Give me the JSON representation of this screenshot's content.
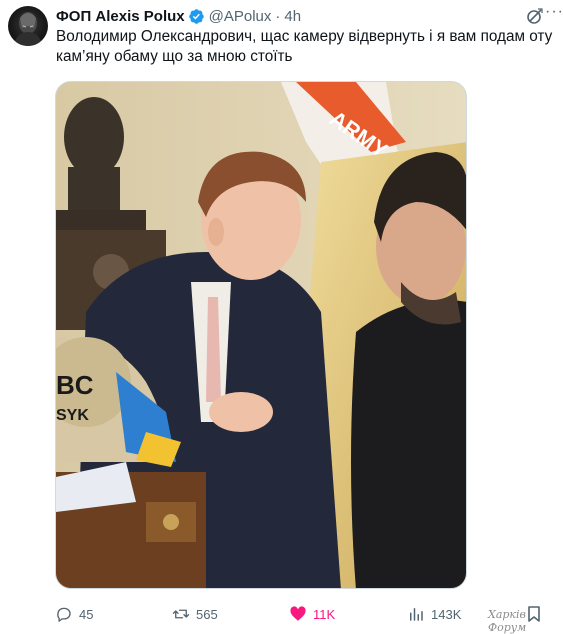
{
  "tweet": {
    "author_name": "ФОП Alexis Polux",
    "handle": "@APolux",
    "separator": "·",
    "time": "4h",
    "text": "Володимир Олександрович, щас камеру відвернуть і я вам подам оту\nкам’яну обаму що за мною стоїть",
    "avatar_icon": "dark-avatar-icon",
    "verified_icon": "verified-badge-icon"
  },
  "media": {
    "description_flag_text": "ARMY",
    "belt_text_1": "BC",
    "belt_text_2": "SYK"
  },
  "actions": {
    "replies": "45",
    "reposts": "565",
    "likes": "11K",
    "views": "143K"
  },
  "watermark": "Харків Форум",
  "colors": {
    "accent": "#1d9bf0",
    "like": "#f91880",
    "muted": "#536471"
  }
}
